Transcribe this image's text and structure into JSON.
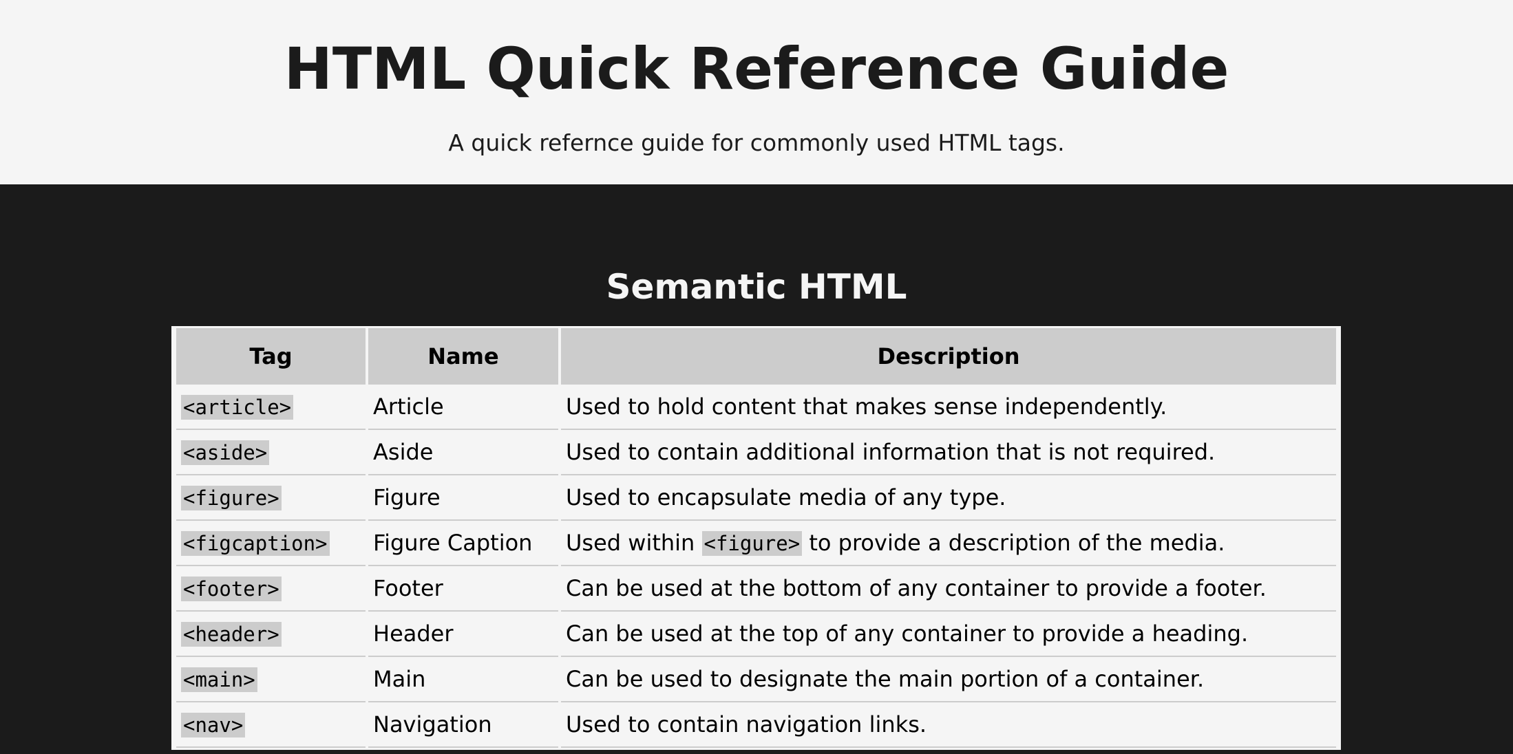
{
  "header": {
    "title": "HTML Quick Reference Guide",
    "subtitle": "A quick refernce guide for commonly used HTML tags."
  },
  "section": {
    "title": "Semantic HTML",
    "columns": {
      "tag": "Tag",
      "name": "Name",
      "description": "Description"
    },
    "rows": [
      {
        "tag": "<article>",
        "name": "Article",
        "desc": "Used to hold content that makes sense independently."
      },
      {
        "tag": "<aside>",
        "name": "Aside",
        "desc": "Used to contain additional information that is not required."
      },
      {
        "tag": "<figure>",
        "name": "Figure",
        "desc": "Used to encapsulate media of any type."
      },
      {
        "tag": "<figcaption>",
        "name": "Figure Caption",
        "desc_pre": "Used within ",
        "desc_code": "<figure>",
        "desc_post": " to provide a description of the media."
      },
      {
        "tag": "<footer>",
        "name": "Footer",
        "desc": "Can be used at the bottom of any container to provide a footer."
      },
      {
        "tag": "<header>",
        "name": "Header",
        "desc": "Can be used at the top of any container to provide a heading."
      },
      {
        "tag": "<main>",
        "name": "Main",
        "desc": "Can be used to designate the main portion of a container."
      },
      {
        "tag": "<nav>",
        "name": "Navigation",
        "desc": "Used to contain navigation links."
      }
    ]
  },
  "colors": {
    "dark_background": "#1b1b1b",
    "light_background": "#f5f5f5",
    "header_cell": "#cccccc",
    "code_background": "#cccccc"
  }
}
